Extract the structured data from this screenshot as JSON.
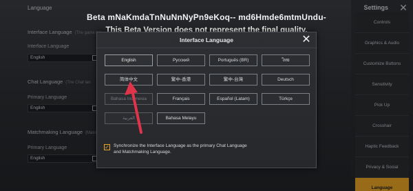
{
  "background": {
    "language_header": "Language",
    "interface_language": {
      "label": "Interface Language",
      "hint": "(The game lan",
      "sub_label": "Interface Language",
      "value": "English"
    },
    "chat_language": {
      "label": "Chat Language",
      "hint": "(The Chat lan",
      "sub_label": "Primary Language",
      "value": "English"
    },
    "matchmaking_language": {
      "label": "Matchmaking Language",
      "hint": "(Matchm",
      "sub_label": "Primary Language",
      "value": "English"
    }
  },
  "settings": {
    "title": "Settings",
    "menu": [
      "Controls",
      "Graphics & Audio",
      "Customize Buttons",
      "Sensitivity",
      "Pick Up",
      "Crosshair",
      "Haptic Feedback",
      "Privacy & Social",
      "Language"
    ],
    "active": "Language"
  },
  "watermark": {
    "line1": "Beta mNaKmdaTnNuNnNyPn9eKoq-- md6Hmde6mtmUndu-",
    "line2": "This Beta Version does not represent the final quality."
  },
  "modal": {
    "title": "Interface Language",
    "languages": [
      [
        "English",
        "Русский",
        "Português (BR)",
        "ไทย"
      ],
      [
        "简体中文",
        "繁中-香港",
        "繁中-台灣",
        "Deutsch"
      ],
      [
        "Bahasa Indonesia",
        "Français",
        "Español (Latam)",
        "Türkçe"
      ],
      [
        "العربية",
        "Bahasa Melayu"
      ]
    ],
    "sync_text": "Synchronize the Interface Language as the primary Chat Language and Matchmaking Language.",
    "sync_checked": true
  },
  "colors": {
    "accent": "#e8a526",
    "arrow": "#e0344a"
  }
}
